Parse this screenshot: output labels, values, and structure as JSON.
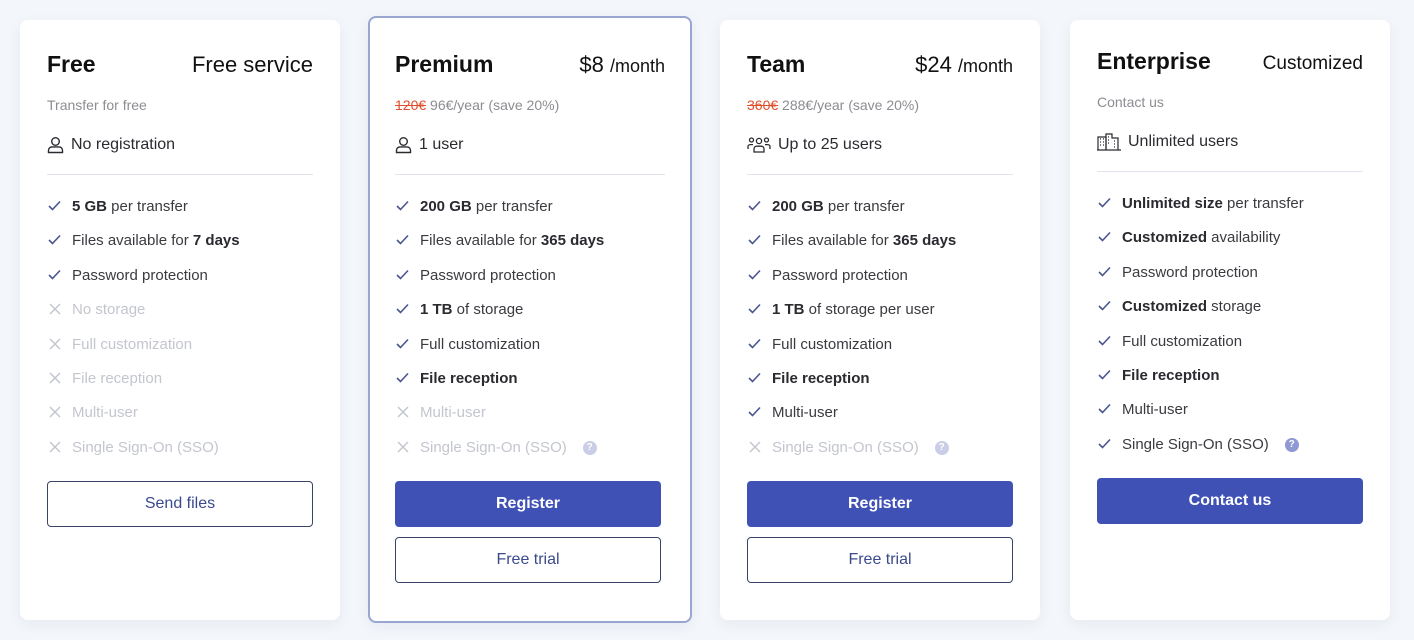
{
  "colors": {
    "accent": "#3f51b5",
    "highlight_border": "#9aa6d2",
    "strikethrough": "#e0502c",
    "check": "#4a5590",
    "cross": "#c3c6ce",
    "background": "#f3f6fa"
  },
  "plans": [
    {
      "name": "Free",
      "price": "Free service",
      "price_per": "",
      "subtitle_old": "",
      "subtitle": "Transfer for free",
      "users_icon": "user-icon",
      "users": "No registration",
      "features": [
        {
          "status": "on",
          "bold": "5 GB",
          "text": " per transfer"
        },
        {
          "status": "on",
          "pre": "Files available for ",
          "bold": "7 days",
          "text": ""
        },
        {
          "status": "on",
          "text": "Password protection"
        },
        {
          "status": "off",
          "text": "No storage"
        },
        {
          "status": "off",
          "text": "Full customization"
        },
        {
          "status": "off",
          "text": "File reception"
        },
        {
          "status": "off",
          "text": "Multi-user"
        },
        {
          "status": "off",
          "text": "Single Sign-On (SSO)"
        }
      ],
      "buttons": [
        {
          "label": "Send files",
          "style": "outline"
        }
      ]
    },
    {
      "name": "Premium",
      "price": "$8",
      "price_per": "/month",
      "subtitle_old": "120€",
      "subtitle": "96€/year (save 20%)",
      "users_icon": "user-icon",
      "users": "1 user",
      "features": [
        {
          "status": "on",
          "bold": "200 GB",
          "text": " per transfer"
        },
        {
          "status": "on",
          "pre": "Files available for ",
          "bold": "365 days",
          "text": ""
        },
        {
          "status": "on",
          "text": "Password protection"
        },
        {
          "status": "on",
          "bold": "1 TB",
          "text": " of storage"
        },
        {
          "status": "on",
          "text": "Full customization"
        },
        {
          "status": "on",
          "bold": "File reception",
          "text": ""
        },
        {
          "status": "off",
          "text": "Multi-user"
        },
        {
          "status": "off",
          "text": "Single Sign-On (SSO)",
          "help": "?"
        }
      ],
      "buttons": [
        {
          "label": "Register",
          "style": "primary"
        },
        {
          "label": "Free trial",
          "style": "outline"
        }
      ]
    },
    {
      "name": "Team",
      "price": "$24",
      "price_per": "/month",
      "subtitle_old": "360€",
      "subtitle": "288€/year (save 20%)",
      "users_icon": "users-group-icon",
      "users": "Up to 25 users",
      "features": [
        {
          "status": "on",
          "bold": "200 GB",
          "text": " per transfer"
        },
        {
          "status": "on",
          "pre": "Files available for ",
          "bold": "365 days",
          "text": ""
        },
        {
          "status": "on",
          "text": "Password protection"
        },
        {
          "status": "on",
          "bold": "1 TB",
          "text": " of storage per user"
        },
        {
          "status": "on",
          "text": "Full customization"
        },
        {
          "status": "on",
          "bold": "File reception",
          "text": ""
        },
        {
          "status": "on",
          "text": "Multi-user"
        },
        {
          "status": "off",
          "text": "Single Sign-On (SSO)",
          "help": "?"
        }
      ],
      "buttons": [
        {
          "label": "Register",
          "style": "primary"
        },
        {
          "label": "Free trial",
          "style": "outline"
        }
      ]
    },
    {
      "name": "Enterprise",
      "price": "Customized",
      "price_per": "",
      "subtitle_old": "",
      "subtitle": "Contact us",
      "users_icon": "building-icon",
      "users": "Unlimited users",
      "features": [
        {
          "status": "on",
          "bold": "Unlimited size",
          "text": " per transfer"
        },
        {
          "status": "on",
          "bold": "Customized",
          "text": " availability"
        },
        {
          "status": "on",
          "text": "Password protection"
        },
        {
          "status": "on",
          "bold": "Customized",
          "text": " storage"
        },
        {
          "status": "on",
          "text": "Full customization"
        },
        {
          "status": "on",
          "bold": "File reception",
          "text": ""
        },
        {
          "status": "on",
          "text": "Multi-user"
        },
        {
          "status": "on",
          "text": "Single Sign-On (SSO)",
          "help": "?"
        }
      ],
      "buttons": [
        {
          "label": "Contact us",
          "style": "primary"
        }
      ]
    }
  ]
}
